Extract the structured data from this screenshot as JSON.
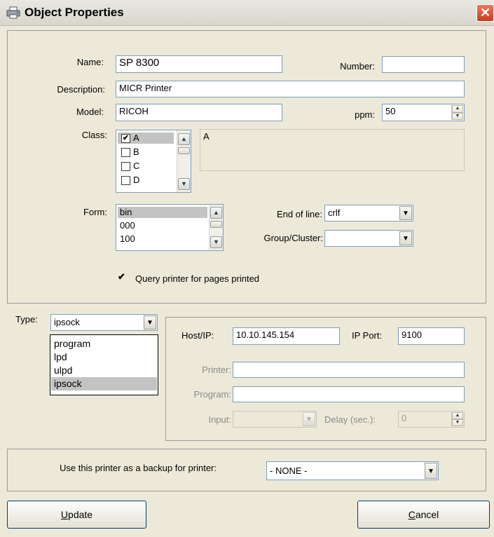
{
  "window": {
    "title": "Object Properties",
    "close_glyph": "✕",
    "icon": "printer-icon"
  },
  "fields": {
    "name": {
      "label": "Name:",
      "value": "SP 8300"
    },
    "number": {
      "label": "Number:",
      "value": ""
    },
    "description": {
      "label": "Description:",
      "value": "MICR Printer"
    },
    "model": {
      "label": "Model:",
      "value": "RICOH"
    },
    "ppm": {
      "label": "ppm:",
      "value": "50"
    }
  },
  "class": {
    "label": "Class:",
    "items": [
      {
        "label": "A",
        "checked": true,
        "selected": true
      },
      {
        "label": "B",
        "checked": false
      },
      {
        "label": "C",
        "checked": false
      },
      {
        "label": "D",
        "checked": false
      }
    ],
    "description": "A"
  },
  "form": {
    "label": "Form:",
    "items": [
      {
        "label": "bin",
        "selected": true
      },
      {
        "label": "000"
      },
      {
        "label": "100"
      }
    ]
  },
  "end_of_line": {
    "label": "End of line:",
    "value": "crlf"
  },
  "group_cluster": {
    "label": "Group/Cluster:",
    "value": ""
  },
  "query_printer": {
    "label": "Query printer for pages printed",
    "checked": true
  },
  "type": {
    "label": "Type:",
    "value": "ipsock",
    "options": [
      "program",
      "lpd",
      "ulpd",
      "ipsock"
    ],
    "selected_index": 3
  },
  "connection": {
    "host": {
      "label": "Host/IP:",
      "value": "10.10.145.154"
    },
    "port": {
      "label": "IP Port:",
      "value": "9100"
    },
    "printer": {
      "label": "Printer:",
      "value": ""
    },
    "program": {
      "label": "Program:",
      "value": ""
    },
    "input": {
      "label": "Input:",
      "value": ""
    },
    "delay": {
      "label": "Delay (sec.):",
      "value": "0"
    }
  },
  "backup": {
    "label": "Use this printer as a backup for printer:",
    "value": "- NONE -"
  },
  "buttons": {
    "update": {
      "label_underlined": "U",
      "label_rest": "pdate"
    },
    "cancel": {
      "label_underlined": "C",
      "label_rest": "ancel"
    }
  },
  "glyphs": {
    "check": "✔",
    "arrow_down": "▼",
    "arrow_up": "▲"
  }
}
